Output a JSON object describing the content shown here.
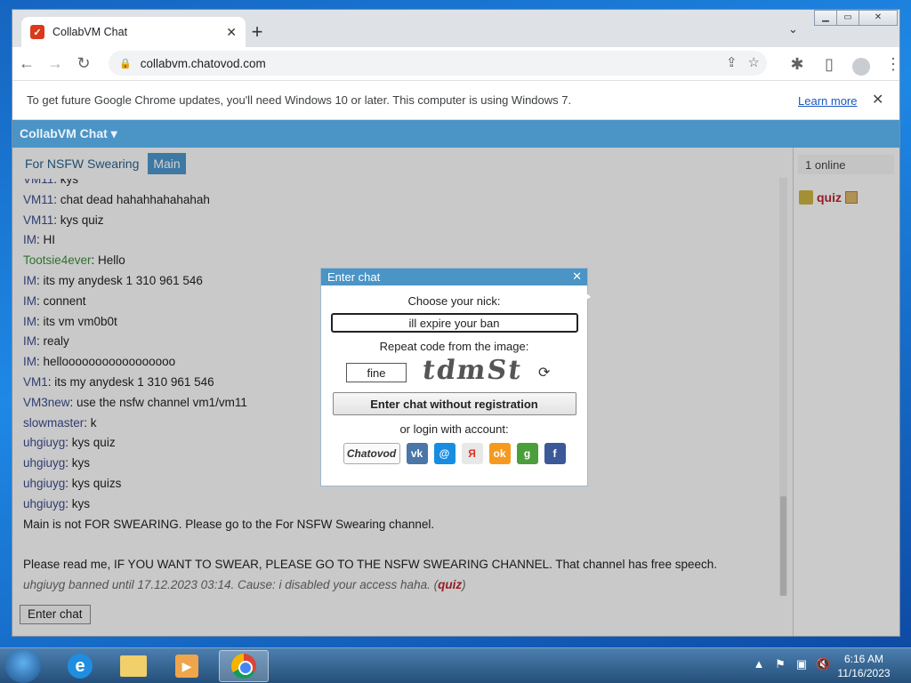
{
  "browser": {
    "tab_title": "CollabVM Chat",
    "tab_close": "✕",
    "new_tab": "+",
    "tab_menu": "⌄",
    "url": "collabvm.chatovod.com",
    "infobar_text": "To get future Google Chrome updates, you'll need Windows 10 or later. This computer is using Windows 7.",
    "infobar_link": "Learn more",
    "infobar_close": "✕"
  },
  "app": {
    "header_title": "CollabVM Chat ▾",
    "channels": [
      "For NSFW Swearing",
      "Main"
    ],
    "active_channel": "Main",
    "messages": [
      {
        "nick": "VM11",
        "text": ": kys"
      },
      {
        "nick": "VM11",
        "text": ": chat dead hahahhahahahah"
      },
      {
        "nick": "VM11",
        "text": ": kys quiz"
      },
      {
        "nick": "IM",
        "text": ": HI"
      },
      {
        "nick": "Tootsie4ever",
        "text": ": Hello",
        "color": "green"
      },
      {
        "nick": "IM",
        "text": ": its my anydesk 1 310 961 546"
      },
      {
        "nick": "IM",
        "text": ": connent"
      },
      {
        "nick": "IM",
        "text": ": its vm vm0b0t"
      },
      {
        "nick": "IM",
        "text": ": realy"
      },
      {
        "nick": "IM",
        "text": ": hellooooooooooooooooo"
      },
      {
        "nick": "VM1",
        "text": ": its my anydesk 1 310 961 546"
      },
      {
        "nick": "VM3new",
        "text": ": use the nsfw channel vm1/vm11"
      },
      {
        "nick": "slowmaster",
        "text": ": k"
      },
      {
        "nick": "uhgiuyg",
        "text": ": kys quiz"
      },
      {
        "nick": "uhgiuyg",
        "text": ": kys"
      },
      {
        "nick": "uhgiuyg",
        "text": ": kys quizs"
      },
      {
        "nick": "uhgiuyg",
        "text": ": kys"
      }
    ],
    "system_msg_1": "Main is not FOR SWEARING. Please go to the For NSFW Swearing channel.",
    "system_msg_2": "Please read me, IF YOU WANT TO SWEAR, PLEASE GO TO THE NSFW SWEARING CHANNEL. That channel has free speech.",
    "ban_msg_prefix": "uhgiuyg banned until 17.12.2023 03:14. Cause: i disabled your access haha. (",
    "ban_msg_user": "quiz",
    "ban_msg_suffix": ")",
    "enter_chat_button": "Enter chat",
    "online_count": "1 online",
    "online_user": "quiz"
  },
  "dialog": {
    "title": "Enter chat",
    "close": "✕",
    "choose_nick_label": "Choose your nick:",
    "nick_value": "ill expire your ban",
    "repeat_code_label": "Repeat code from the image:",
    "code_value": "fine",
    "captcha_text": "tdmSt",
    "refresh_icon": "⟳",
    "enter_without_registration": "Enter chat without registration",
    "login_with_account": "or login with account:",
    "socials": [
      {
        "name": "Chatovod",
        "label": "Chatovod",
        "color": "#fafafa"
      },
      {
        "name": "VK",
        "label": "vk",
        "color": "#4a76a8"
      },
      {
        "name": "Mail.ru",
        "label": "@",
        "color": "#168de2"
      },
      {
        "name": "Yandex",
        "label": "Я",
        "color": "#e8e8e8"
      },
      {
        "name": "Odnoklassniki",
        "label": "ok",
        "color": "#f59a1f"
      },
      {
        "name": "Google",
        "label": "g",
        "color": "#4a9f3a"
      },
      {
        "name": "Facebook",
        "label": "f",
        "color": "#3b5998"
      }
    ]
  },
  "taskbar": {
    "time": "6:16 AM",
    "date": "11/16/2023",
    "tray_icons": [
      "▲",
      "⚑",
      "▣",
      "🔇"
    ]
  }
}
